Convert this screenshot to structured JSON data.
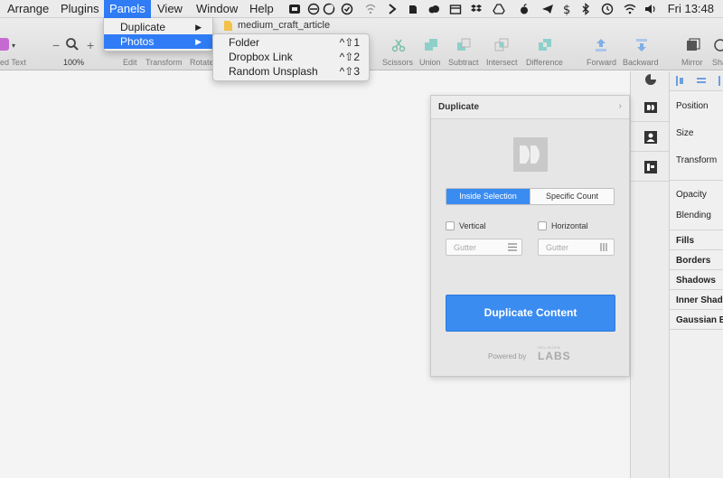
{
  "menubar": {
    "items": [
      "Arrange",
      "Plugins",
      "Panels",
      "View",
      "Window",
      "Help"
    ],
    "clock": "Fri 13:48"
  },
  "document": {
    "title": "medium_craft_article"
  },
  "toolbar": {
    "left_fragment": "ed Text",
    "zoom_value": "100%",
    "zoom_minus": "−",
    "zoom_plus": "+",
    "labels": {
      "edit": "Edit",
      "transform": "Transform",
      "rotate": "Rotate",
      "scissors": "Scissors",
      "union": "Union",
      "subtract": "Subtract",
      "intersect": "Intersect",
      "difference": "Difference",
      "forward": "Forward",
      "backward": "Backward",
      "mirror": "Mirror",
      "share": "Sha"
    }
  },
  "panels_menu": {
    "items": [
      {
        "label": "Duplicate",
        "arrow": "▶"
      },
      {
        "label": "Photos",
        "arrow": "▶"
      }
    ]
  },
  "photos_menu": {
    "items": [
      {
        "label": "Folder",
        "shortcut": "^⇧1"
      },
      {
        "label": "Dropbox Link",
        "shortcut": "^⇧2"
      },
      {
        "label": "Random Unsplash",
        "shortcut": "^⇧3"
      }
    ]
  },
  "duplicate_panel": {
    "title": "Duplicate",
    "chevron": "›",
    "mode_active": "Inside Selection",
    "mode_inactive": "Specific Count",
    "vertical_label": "Vertical",
    "horizontal_label": "Horizontal",
    "gutter_placeholder_left": "Gutter",
    "gutter_placeholder_right": "Gutter",
    "button_label": "Duplicate Content",
    "powered_by": "Powered by",
    "brand_small": "INVISION",
    "brand": "LABS",
    "accent_color": "#3b8cf0"
  },
  "inspector": {
    "rows": [
      "Position",
      "Size",
      "Transform",
      "Opacity",
      "Blending"
    ],
    "sections": [
      "Fills",
      "Borders",
      "Shadows",
      "Inner Shado",
      "Gaussian B"
    ]
  }
}
